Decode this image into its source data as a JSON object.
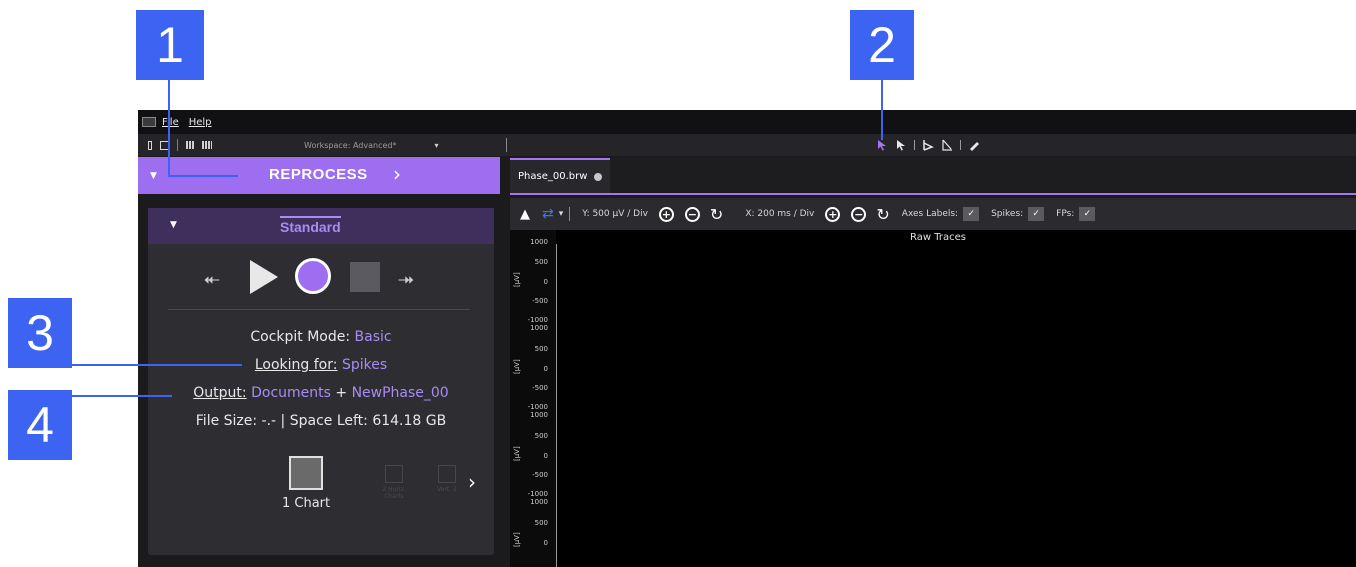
{
  "callouts": [
    "1",
    "2",
    "3",
    "4"
  ],
  "menu": {
    "file": "File",
    "help": "Help"
  },
  "toolbar": {
    "workspace_label": "Workspace: Advanced*",
    "workspace_caret": "▾"
  },
  "reprocess": {
    "caret": "▼",
    "label": "REPROCESS",
    "chevron": "›"
  },
  "panel": {
    "caret": "▼",
    "title": "Standard",
    "cockpit_label": "Cockpit Mode:",
    "cockpit_value": "Basic",
    "looking_label": "Looking for:",
    "looking_value": "Spikes",
    "output_label": "Output:",
    "output_folder": "Documents",
    "output_plus": "+",
    "output_name": "NewPhase_00",
    "file_size": "File Size: -.- | Space Left: 614.18 GB",
    "charts": [
      {
        "label": "1 Chart",
        "selected": true
      },
      {
        "label": "2 Horiz. Charts",
        "selected": false
      },
      {
        "label": "Vert. 2",
        "selected": false
      }
    ],
    "next": "›"
  },
  "tabs": [
    {
      "label": "Phase_00.brw"
    }
  ],
  "plot_toolbar": {
    "up_icon": "▲",
    "arrows_icon": "⇄",
    "caret": "▾",
    "y_scale": "Y: 500 µV / Div",
    "x_scale": "X: 200 ms / Div",
    "zoom_in": "+",
    "zoom_out": "−",
    "reset": "↻",
    "axes_labels": "Axes Labels:",
    "spikes": "Spikes:",
    "fps": "FPs:",
    "check": "✓"
  },
  "plot": {
    "title": "Raw Traces",
    "y_unit": "[µV]",
    "groups": [
      {
        "ticks": [
          "1000",
          "500",
          "0",
          "-500"
        ]
      },
      {
        "ticks": [
          "-1000",
          "1000",
          "500",
          "0",
          "-500"
        ]
      },
      {
        "ticks": [
          "-1000",
          "1000",
          "500",
          "0",
          "-500"
        ]
      },
      {
        "ticks": [
          "-1000",
          "1000",
          "500",
          "0"
        ]
      }
    ]
  },
  "colors": {
    "accent": "#9d6ef0",
    "callout": "#3d63f2",
    "panel": "#2e2d32",
    "panel_header": "#3f2f5c",
    "value_text": "#a88cf2"
  }
}
